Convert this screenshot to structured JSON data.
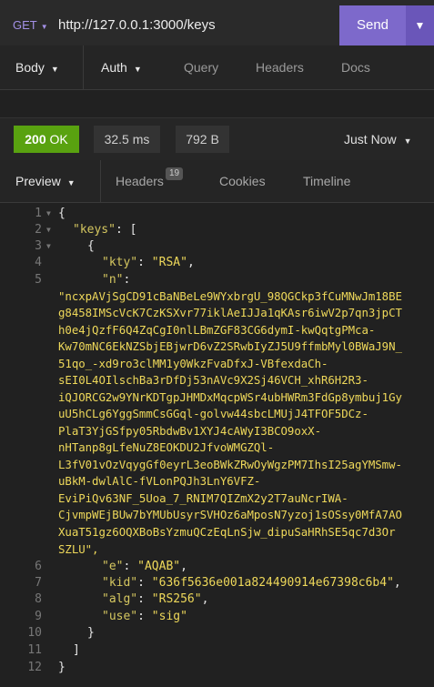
{
  "request": {
    "method": "GET",
    "url": "http://127.0.0.1:3000/keys",
    "send_label": "Send"
  },
  "request_tabs": [
    {
      "label": "Body"
    },
    {
      "label": "Auth"
    },
    {
      "label": "Query"
    },
    {
      "label": "Headers"
    },
    {
      "label": "Docs"
    }
  ],
  "response": {
    "status_code": "200",
    "status_text": "OK",
    "time": "32.5 ms",
    "size": "792 B",
    "when": "Just Now"
  },
  "response_tabs": [
    {
      "label": "Preview"
    },
    {
      "label": "Headers",
      "badge": "19"
    },
    {
      "label": "Cookies"
    },
    {
      "label": "Timeline"
    }
  ],
  "code": {
    "line_numbers": [
      "1",
      "2",
      "3",
      "4",
      "5",
      "6",
      "7",
      "8",
      "9",
      "10",
      "11",
      "12"
    ],
    "l1": "{",
    "l2_key": "\"keys\"",
    "l2_rest": ": [",
    "l3": "{",
    "l4_key": "\"kty\"",
    "l4_val": "\"RSA\"",
    "l5_key": "\"n\"",
    "n_lines": [
      "\"ncxpAVjSgCD91cBaNBeLe9WYxbrgU_98QGCkp3fCuMNwJm18BE",
      "g8458IMScVcK7CzKSXvr77iklAeIJJa1qKAsr6iwV2p7qn3jpCT",
      "h0e4jQzfF6Q4ZqCgI0nlLBmZGF83CG6dymI-kwQqtgPMca-",
      "Kw70mNC6EkNZSbjEBjwrD6vZ2SRwbIyZJ5U9ffmbMyl0BWaJ9N_",
      "51qo_-xd9ro3clMM1y0WkzFvaDfxJ-VBfexdaCh-",
      "sEI0L4OIlschBa3rDfDj53nAVc9X2Sj46VCH_xhR6H2R3-",
      "iQJORCG2w9YNrKDTgpJHMDxMqcpWSr4ubHWRm3FdGp8ymbuj1Gy",
      "uU5hCLg6YggSmmCsGGql-golvw44sbcLMUjJ4TFOF5DCz-",
      "PlaT3YjGSfpy05RbdwBv1XYJ4cAWyI3BCO9oxX-",
      "nHTanp8gLfeNuZ8EOKDU2JfvoWMGZQl-",
      "L3fV01vOzVqygGf0eyrL3eoBWkZRwOyWgzPM7IhsI25agYMSmw-",
      "uBkM-dwlAlC-fVLonPQJh3LnY6VFZ-",
      "EviPiQv63NF_5Uoa_7_RNIM7QIZmX2y2T7auNcrIWA-",
      "CjvmpWEjBUw7bYMUbUsyrSVHOz6aMposN7yzoj1sOSsy0MfA7AO",
      "XuaT51gz6OQXBoBsYzmuQCzEqLnSjw_dipuSaHRhSE5qc7d3Or",
      "SZLU\","
    ],
    "l6_key": "\"e\"",
    "l6_val": "\"AQAB\"",
    "l7_key": "\"kid\"",
    "l7_val": "\"636f5636e001a824490914e67398c6b4\"",
    "l8_key": "\"alg\"",
    "l8_val": "\"RS256\"",
    "l9_key": "\"use\"",
    "l9_val": "\"sig\"",
    "l10": "}",
    "l11": "]",
    "l12": "}"
  }
}
